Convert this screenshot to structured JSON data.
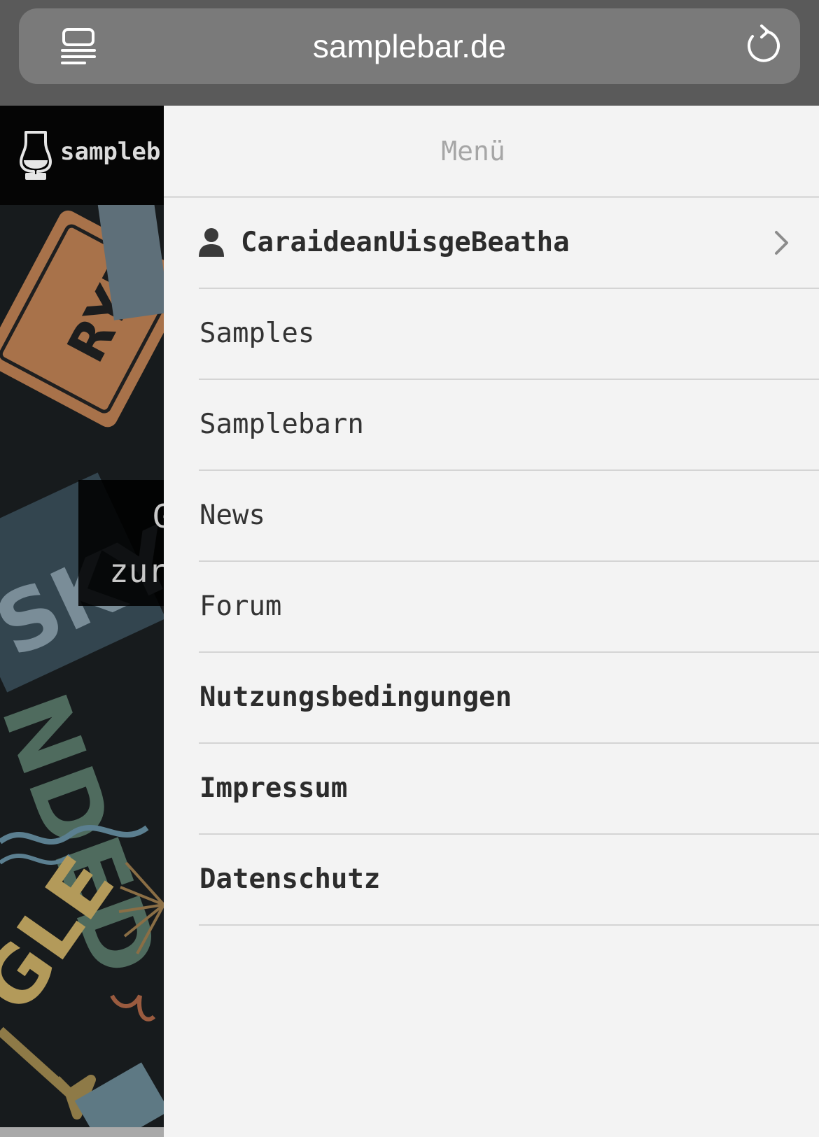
{
  "browser": {
    "url": "samplebar.de",
    "reader_icon": "reader-mode-icon",
    "reload_icon": "reload-icon"
  },
  "background_page": {
    "site_name": "sampleb",
    "logo_icon": "glencairn-glass-icon",
    "hero_line1": "G",
    "hero_line2": "zur"
  },
  "drawer": {
    "title": "Menü",
    "user": {
      "name": "CaraideanUisgeBeatha",
      "icon": "user-icon",
      "chevron": "chevron-right-icon"
    },
    "items": [
      {
        "label": "Samples",
        "bold": false
      },
      {
        "label": "Samplebarn",
        "bold": false
      },
      {
        "label": "News",
        "bold": false
      },
      {
        "label": "Forum",
        "bold": false
      },
      {
        "label": "Nutzungsbedingungen",
        "bold": true
      },
      {
        "label": "Impressum",
        "bold": true
      },
      {
        "label": "Datenschutz",
        "bold": true
      }
    ]
  },
  "colors": {
    "chrome": "#5a5a5a",
    "urlbar": "#7a7a7a",
    "drawer_bg": "#f3f3f3",
    "divider": "#d4d4d4",
    "text": "#333333",
    "title": "#a6a6a6"
  }
}
